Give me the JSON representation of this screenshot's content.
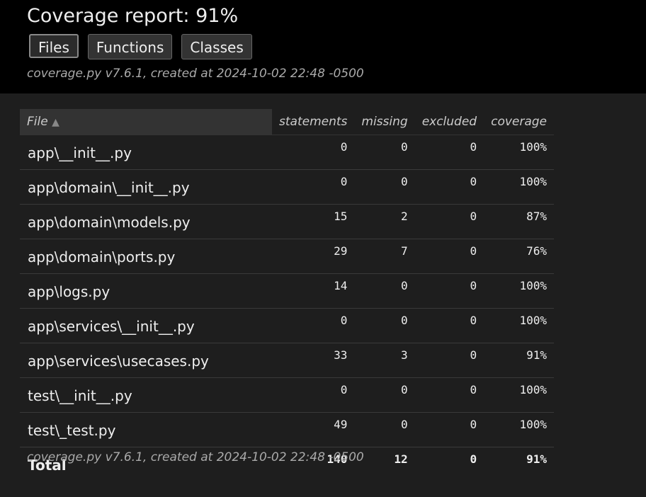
{
  "header": {
    "title": "Coverage report: 91%",
    "buttons": [
      {
        "label": "Files",
        "active": true
      },
      {
        "label": "Functions",
        "active": false
      },
      {
        "label": "Classes",
        "active": false
      }
    ],
    "meta": "coverage.py v7.6.1, created at 2024-10-02 22:48 -0500"
  },
  "table": {
    "columns": {
      "file": "File",
      "sort_indicator": "▲",
      "statements": "statements",
      "missing": "missing",
      "excluded": "excluded",
      "coverage": "coverage"
    },
    "rows": [
      {
        "file": "app\\__init__.py",
        "statements": "0",
        "missing": "0",
        "excluded": "0",
        "coverage": "100%"
      },
      {
        "file": "app\\domain\\__init__.py",
        "statements": "0",
        "missing": "0",
        "excluded": "0",
        "coverage": "100%"
      },
      {
        "file": "app\\domain\\models.py",
        "statements": "15",
        "missing": "2",
        "excluded": "0",
        "coverage": "87%"
      },
      {
        "file": "app\\domain\\ports.py",
        "statements": "29",
        "missing": "7",
        "excluded": "0",
        "coverage": "76%"
      },
      {
        "file": "app\\logs.py",
        "statements": "14",
        "missing": "0",
        "excluded": "0",
        "coverage": "100%"
      },
      {
        "file": "app\\services\\__init__.py",
        "statements": "0",
        "missing": "0",
        "excluded": "0",
        "coverage": "100%"
      },
      {
        "file": "app\\services\\usecases.py",
        "statements": "33",
        "missing": "3",
        "excluded": "0",
        "coverage": "91%"
      },
      {
        "file": "test\\__init__.py",
        "statements": "0",
        "missing": "0",
        "excluded": "0",
        "coverage": "100%"
      },
      {
        "file": "test\\_test.py",
        "statements": "49",
        "missing": "0",
        "excluded": "0",
        "coverage": "100%"
      }
    ],
    "total": {
      "file": "Total",
      "statements": "140",
      "missing": "12",
      "excluded": "0",
      "coverage": "91%"
    }
  },
  "footer": {
    "meta": "coverage.py v7.6.1, created at 2024-10-02 22:48 -0500"
  }
}
